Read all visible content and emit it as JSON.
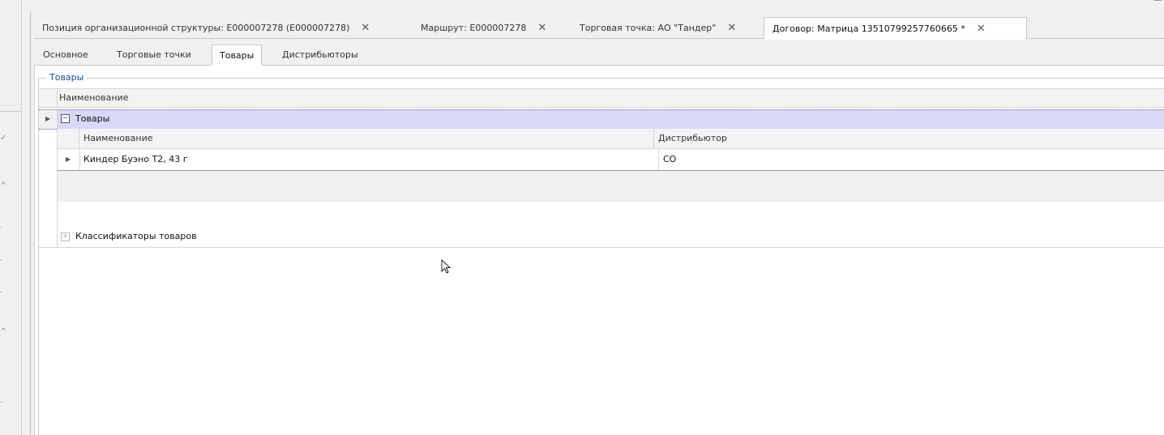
{
  "document_tabs": [
    {
      "label": "Позиция организационной структуры: E000007278 (E000007278)",
      "active": false
    },
    {
      "label": "Маршрут: E000007278",
      "active": false
    },
    {
      "label": "Торговая точка: АО \"Тандер\"",
      "active": false
    },
    {
      "label": "Договор: Матрица 13510799257760665 *",
      "active": true
    }
  ],
  "close_symbol": "✕",
  "inner_tabs": [
    {
      "label": "Основное",
      "active": false
    },
    {
      "label": "Торговые точки",
      "active": false
    },
    {
      "label": "Товары",
      "active": true
    },
    {
      "label": "Дистрибьюторы",
      "active": false
    }
  ],
  "group": {
    "caption": "Товары"
  },
  "grid": {
    "header": "Наименование",
    "group_row_label": "Товары",
    "detail": {
      "columns": [
        "Наименование",
        "Дистрибьютор"
      ],
      "rows": [
        {
          "name": "Киндер Буэно Т2, 43 г",
          "distributor": "СО"
        }
      ]
    },
    "classifier_row_label": "Классификаторы товаров"
  },
  "colors": {
    "accent": "#1c4fa0",
    "selected_row": "#d8d8f8"
  },
  "icons": {
    "expand_minus": "⊟",
    "expand_plus": "⊞",
    "row_arrow": "▶"
  }
}
